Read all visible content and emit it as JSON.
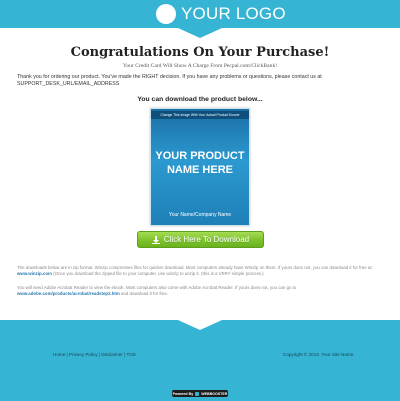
{
  "header": {
    "logo_text": "YOUR LOGO",
    "logo_icon": "circle-logo-icon"
  },
  "main": {
    "title": "Congratulations On Your Purchase!",
    "subtitle": "Your Credit Card Will Show A Charge From Pecpal.com/ClickBank!",
    "intro": "Thank you for ordering our product. You've made the RIGHT decision. If you have any problems or questions, please contact us at SUPPORT_DESK_URL/EMAIL_ADDRESS",
    "download_heading": "You can download the product below...",
    "cover": {
      "banner": "Change This Image With Your Actual Product Ecover",
      "title": "YOUR PRODUCT NAME HERE",
      "author": "Your Name/Company Name"
    },
    "download_button": {
      "label": "Click Here To Download",
      "icon": "download-arrow-icon"
    },
    "note1": {
      "text_before": "The downloads below are in zip format. Winzip compresses files for quicker download. Most computers already have WinZip on them. If yours does not, you can download it for free at: ",
      "link": "www.winzip.com",
      "text_after": " (Once you download the zipped file to your computer, use winzip to unzip it. (this is a VERY simple process.)"
    },
    "note2": {
      "text_before": "You will need Adobe Acrobat Reader to view the ebook. Most computers also come with Adobe Acrobat Reader. If yours does not, you can go to ",
      "link": "www.adobe.com/products/acrobat/readstep2.htm",
      "text_after": " and download it for free."
    }
  },
  "footer": {
    "links": [
      "Home",
      "Privacy Policy",
      "Disclaimer",
      "TOS"
    ],
    "separator": " | ",
    "copyright": "Copyright © 2013. Your Site Name.",
    "powered_prefix": "Powered By",
    "powered_brand": "WEBBOOSTER"
  },
  "colors": {
    "brand": "#36b4d4",
    "button_green": "#7cc22b",
    "cover_blue": "#2b99cf",
    "link": "#2a7ab0"
  }
}
